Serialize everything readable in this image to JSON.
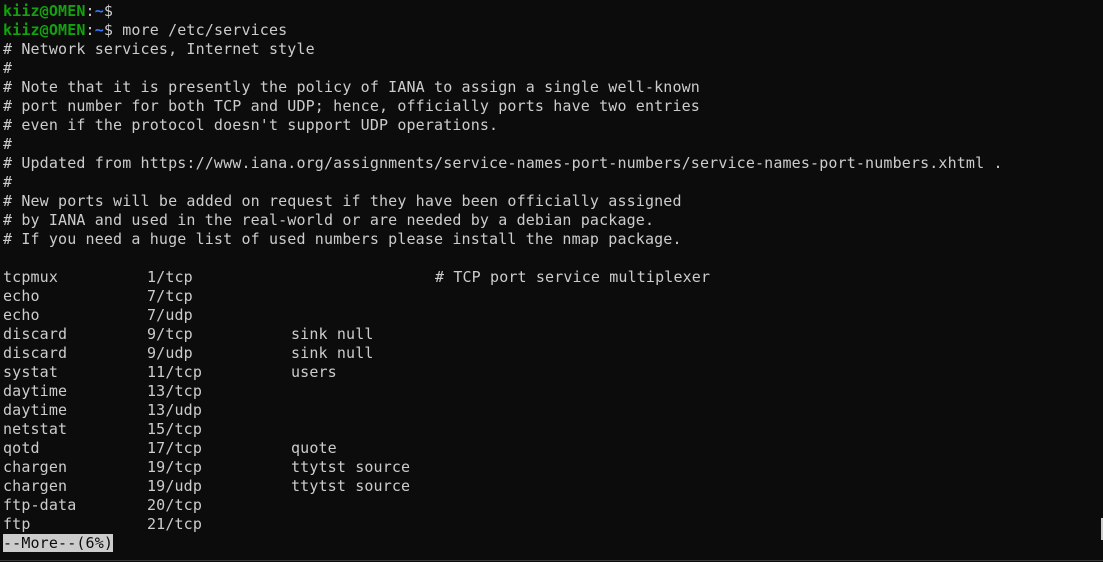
{
  "prompt": {
    "user_host": "kiiz@OMEN",
    "separator": ":",
    "cwd": "~",
    "symbol": "$ "
  },
  "commands": [
    "",
    "more /etc/services"
  ],
  "header_comments": [
    "# Network services, Internet style",
    "#",
    "# Note that it is presently the policy of IANA to assign a single well-known",
    "# port number for both TCP and UDP; hence, officially ports have two entries",
    "# even if the protocol doesn't support UDP operations.",
    "#",
    "# Updated from https://www.iana.org/assignments/service-names-port-numbers/service-names-port-numbers.xhtml .",
    "#",
    "# New ports will be added on request if they have been officially assigned",
    "# by IANA and used in the real-world or are needed by a debian package.",
    "# If you need a huge list of used numbers please install the nmap package."
  ],
  "services": [
    {
      "name": "tcpmux",
      "port": "1/tcp",
      "aliases": "",
      "comment": "# TCP port service multiplexer"
    },
    {
      "name": "echo",
      "port": "7/tcp",
      "aliases": "",
      "comment": ""
    },
    {
      "name": "echo",
      "port": "7/udp",
      "aliases": "",
      "comment": ""
    },
    {
      "name": "discard",
      "port": "9/tcp",
      "aliases": "sink null",
      "comment": ""
    },
    {
      "name": "discard",
      "port": "9/udp",
      "aliases": "sink null",
      "comment": ""
    },
    {
      "name": "systat",
      "port": "11/tcp",
      "aliases": "users",
      "comment": ""
    },
    {
      "name": "daytime",
      "port": "13/tcp",
      "aliases": "",
      "comment": ""
    },
    {
      "name": "daytime",
      "port": "13/udp",
      "aliases": "",
      "comment": ""
    },
    {
      "name": "netstat",
      "port": "15/tcp",
      "aliases": "",
      "comment": ""
    },
    {
      "name": "qotd",
      "port": "17/tcp",
      "aliases": "quote",
      "comment": ""
    },
    {
      "name": "chargen",
      "port": "19/tcp",
      "aliases": "ttytst source",
      "comment": ""
    },
    {
      "name": "chargen",
      "port": "19/udp",
      "aliases": "ttytst source",
      "comment": ""
    },
    {
      "name": "ftp-data",
      "port": "20/tcp",
      "aliases": "",
      "comment": ""
    },
    {
      "name": "ftp",
      "port": "21/tcp",
      "aliases": "",
      "comment": ""
    }
  ],
  "pager_status": "--More--(6%)",
  "colors": {
    "background": "#0c0c0c",
    "foreground": "#cccccc",
    "user_host": "#13a10e",
    "path": "#3b78ff"
  }
}
